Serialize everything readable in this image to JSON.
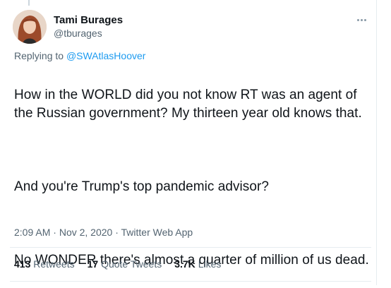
{
  "author": {
    "name": "Tami Burages",
    "handle": "@tburages"
  },
  "reply": {
    "prefix": "Replying to",
    "target": "@SWAtlasHoover"
  },
  "tweet": {
    "paragraph1": "How in the WORLD did you not know RT was an agent of the Russian government? My thirteen year old knows that.",
    "paragraph2": "And you're Trump's top pandemic advisor?",
    "paragraph3": "No WONDER there's almost a quarter of million of us dead."
  },
  "meta": {
    "time": "2:09 AM",
    "date": "Nov 2, 2020",
    "source": "Twitter Web App"
  },
  "stats": {
    "retweets_count": "413",
    "retweets_label": "Retweets",
    "quotes_count": "17",
    "quotes_label": "Quote Tweets",
    "likes_count": "3.7K",
    "likes_label": "Likes"
  }
}
